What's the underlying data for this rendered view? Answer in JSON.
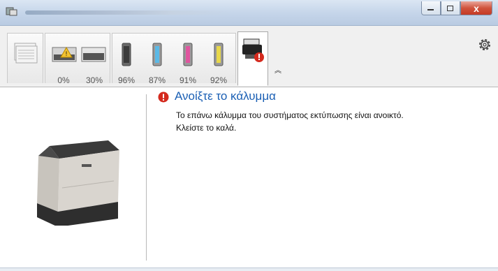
{
  "window": {
    "minimize_icon": "minimize-icon",
    "maximize_icon": "maximize-icon",
    "close_label": "x"
  },
  "toolbar": {
    "tabs": [
      {
        "name": "paper-stack",
        "percent": ""
      },
      {
        "name": "tray-1",
        "percent": "0%"
      },
      {
        "name": "tray-2",
        "percent": "30%"
      },
      {
        "name": "toner-black",
        "percent": "96%",
        "color": "#4a4a4a"
      },
      {
        "name": "toner-cyan",
        "percent": "87%",
        "color": "#5bb9e6"
      },
      {
        "name": "toner-magenta",
        "percent": "91%",
        "color": "#e0559f"
      },
      {
        "name": "toner-yellow",
        "percent": "92%",
        "color": "#e8d84a"
      },
      {
        "name": "printer-status",
        "percent": ""
      }
    ],
    "collapse_glyph": "︽"
  },
  "status": {
    "title": "Ανοίξτε το κάλυμμα",
    "line1": "Το επάνω κάλυμμα του συστήματος εκτύπωσης είναι ανοικτό.",
    "line2": "Κλείστε το καλά."
  },
  "colors": {
    "title": "#1a5fb4",
    "error": "#d42a1e"
  }
}
